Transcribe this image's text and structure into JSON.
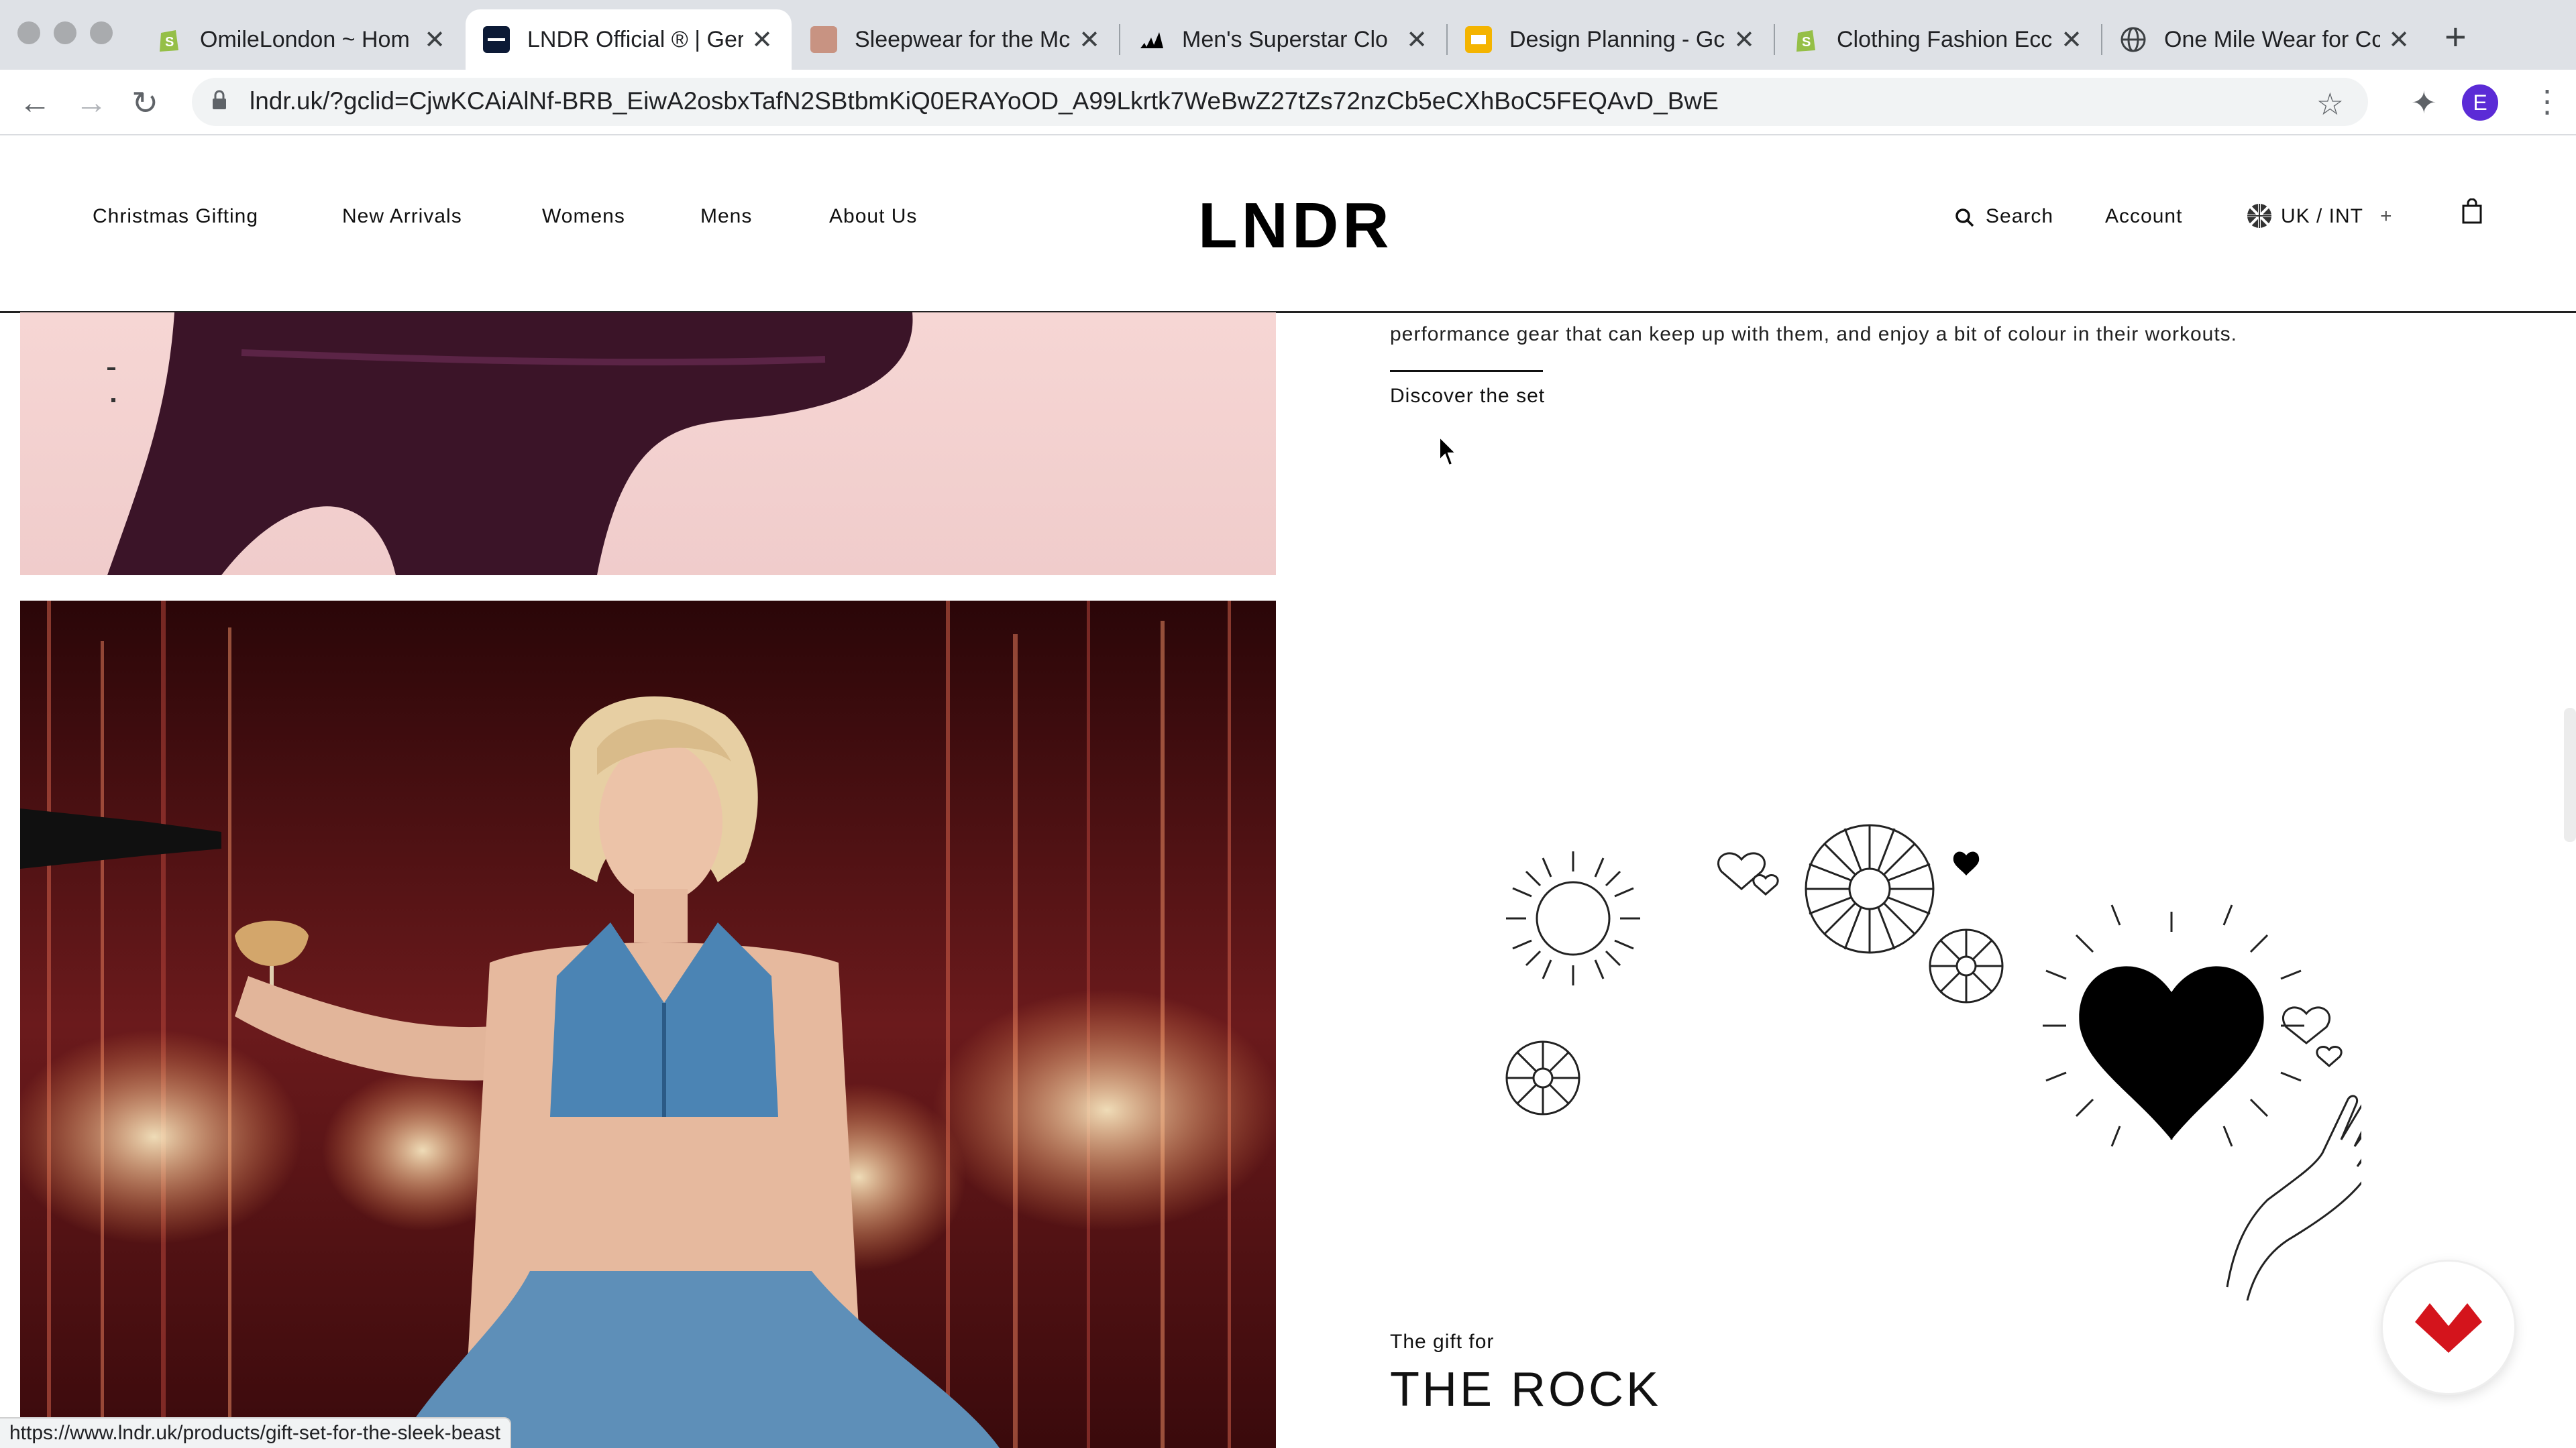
{
  "browser": {
    "tabs": [
      {
        "title": "OmileLondon ~ Hom",
        "favicon": "shopify-icon",
        "active": false
      },
      {
        "title": "LNDR Official ® | Ger",
        "favicon": "lndr-icon",
        "active": true
      },
      {
        "title": "Sleepwear for the Mc",
        "favicon": "image-icon",
        "active": false
      },
      {
        "title": "Men's Superstar Clo",
        "favicon": "adidas-icon",
        "active": false
      },
      {
        "title": "Design Planning - Gc",
        "favicon": "slides-icon",
        "active": false
      },
      {
        "title": "Clothing Fashion Ecc",
        "favicon": "shopify-icon",
        "active": false
      },
      {
        "title": "One Mile Wear for Cc",
        "favicon": "globe-icon",
        "active": false
      }
    ],
    "url": "lndr.uk/?gclid=CjwKCAiAlNf-BRB_EiwA2osbxTafN2SBtbmKiQ0ERAYoOD_A99Lkrtk7WeBwZ27tZs72nzCb5eCXhBoC5FEQAvD_BwE",
    "profile_initial": "E",
    "close_glyph": "✕",
    "newtab_glyph": "+",
    "back_glyph": "←",
    "forward_glyph": "→",
    "reload_glyph": "↻",
    "star_glyph": "☆",
    "puzzle_glyph": "✦",
    "kebab_glyph": "⋮"
  },
  "site": {
    "nav": [
      "Christmas Gifting",
      "New Arrivals",
      "Womens",
      "Mens",
      "About Us"
    ],
    "logo": "LNDR",
    "search_label": "Search",
    "account_label": "Account",
    "region_label": "UK / INT",
    "region_plus": "+"
  },
  "content": {
    "copy_line": "performance gear that can keep up with them, and enjoy a bit of colour in their workouts.",
    "discover_link": "Discover the set",
    "gift_kicker": "The gift for",
    "gift_title": "THE ROCK"
  },
  "status_bar_url": "https://www.lndr.uk/products/gift-set-for-the-sleek-beast",
  "colors": {
    "accent_red": "#d4141c",
    "profile": "#5b2bd6",
    "shopify_green": "#95bf47",
    "slides_yellow": "#f4b400"
  }
}
